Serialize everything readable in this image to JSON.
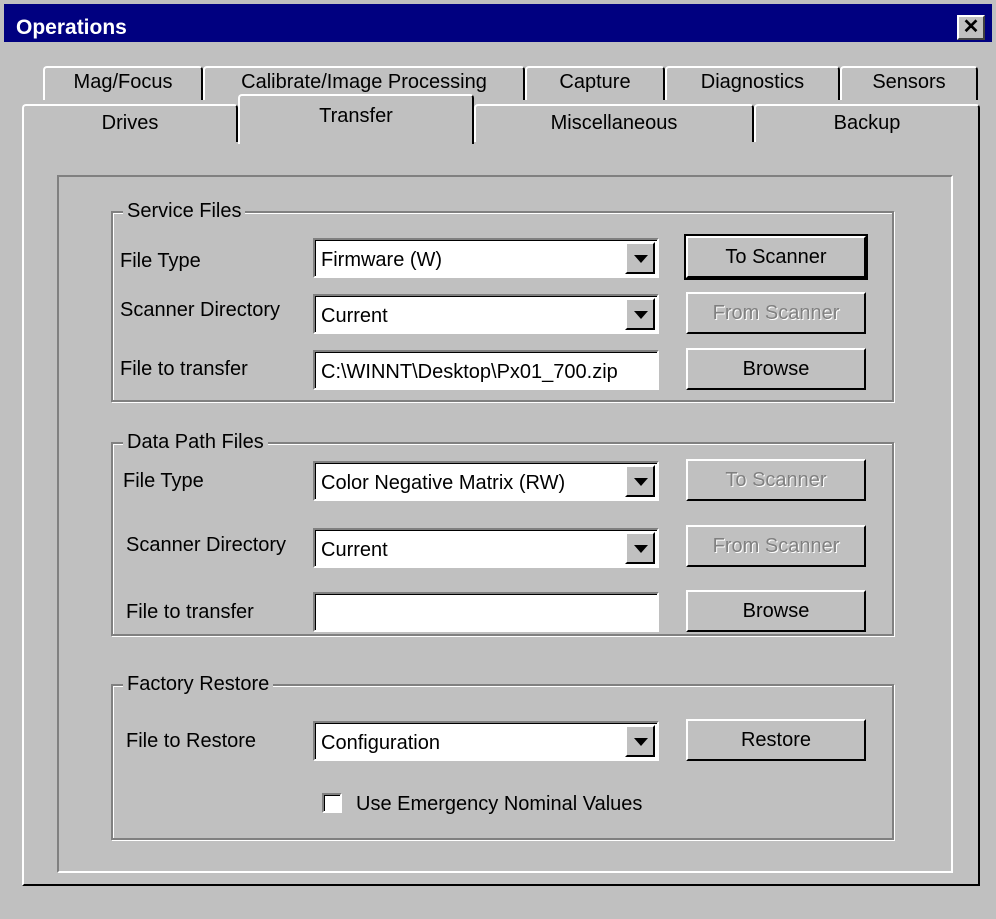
{
  "window": {
    "title": "Operations",
    "close_glyph": "✕"
  },
  "tabs_row1": [
    {
      "label": "Mag/Focus"
    },
    {
      "label": "Calibrate/Image Processing"
    },
    {
      "label": "Capture"
    },
    {
      "label": "Diagnostics"
    },
    {
      "label": "Sensors"
    }
  ],
  "tabs_row2": [
    {
      "label": "Drives"
    },
    {
      "label": "Transfer",
      "selected": true
    },
    {
      "label": "Miscellaneous"
    },
    {
      "label": "Backup"
    }
  ],
  "service_files": {
    "legend": "Service Files",
    "file_type_label": "File Type",
    "file_type_value": "Firmware (W)",
    "scanner_dir_label": "Scanner Directory",
    "scanner_dir_value": "Current",
    "file_transfer_label": "File to transfer",
    "file_transfer_value": "C:\\WINNT\\Desktop\\Px01_700.zip",
    "to_scanner_btn": "To Scanner",
    "from_scanner_btn": "From Scanner",
    "browse_btn": "Browse"
  },
  "data_path_files": {
    "legend": "Data Path Files",
    "file_type_label": "File Type",
    "file_type_value": "Color Negative Matrix (RW)",
    "scanner_dir_label": "Scanner Directory",
    "scanner_dir_value": "Current",
    "file_transfer_label": "File to transfer",
    "file_transfer_value": "",
    "to_scanner_btn": "To Scanner",
    "from_scanner_btn": "From Scanner",
    "browse_btn": "Browse"
  },
  "factory_restore": {
    "legend": "Factory Restore",
    "file_restore_label": "File to Restore",
    "file_restore_value": "Configuration",
    "restore_btn": "Restore",
    "emergency_checkbox_label": "Use Emergency Nominal Values",
    "emergency_checked": false
  },
  "colors": {
    "titlebar": "#000080",
    "face": "#c0c0c0",
    "disabled_text": "#808080"
  }
}
